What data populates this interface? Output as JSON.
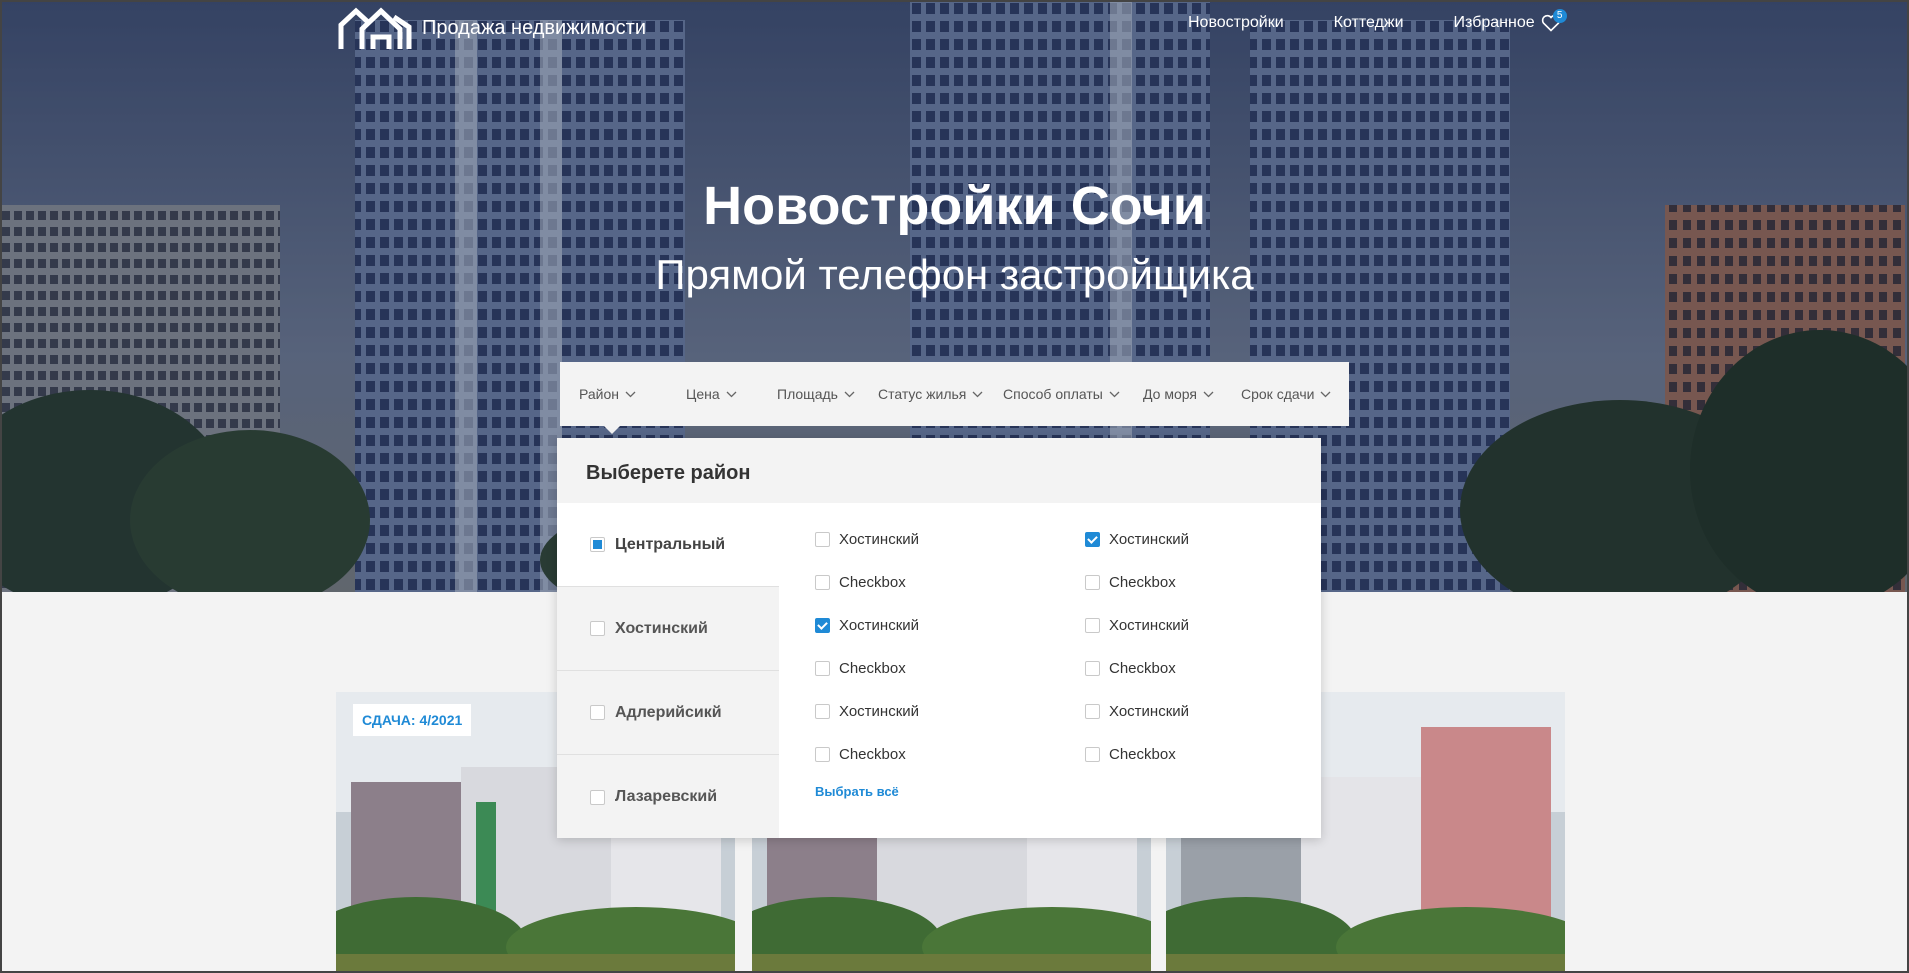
{
  "header": {
    "logo_text": "Продажа недвижимости",
    "nav": [
      "Новостройки",
      "Коттеджи",
      "Избранное"
    ],
    "favorites_count": "5"
  },
  "hero": {
    "title": "Новостройки Сочи",
    "subtitle": "Прямой телефон застройщика"
  },
  "filters": [
    "Район",
    "Цена",
    "Площадь",
    "Статус жилья",
    "Способ оплаты",
    "До моря",
    "Срок сдачи"
  ],
  "dropdown": {
    "title": "Выберете район",
    "districts": [
      {
        "label": "Центральный",
        "state": "partial"
      },
      {
        "label": "Хостинский",
        "state": "unchecked"
      },
      {
        "label": "Адлерийсикй",
        "state": "unchecked"
      },
      {
        "label": "Лазаревский",
        "state": "unchecked"
      }
    ],
    "options": [
      {
        "label": "Хостинский",
        "checked": false
      },
      {
        "label": "Хостинский",
        "checked": true
      },
      {
        "label": "Checkbox",
        "checked": false
      },
      {
        "label": "Checkbox",
        "checked": false
      },
      {
        "label": "Хостинский",
        "checked": true
      },
      {
        "label": "Хостинский",
        "checked": false
      },
      {
        "label": "Checkbox",
        "checked": false
      },
      {
        "label": "Checkbox",
        "checked": false
      },
      {
        "label": "Хостинский",
        "checked": false
      },
      {
        "label": "Хостинский",
        "checked": false
      },
      {
        "label": "Checkbox",
        "checked": false
      },
      {
        "label": "Checkbox",
        "checked": false
      }
    ],
    "select_all": "Выбрать всё"
  },
  "cards": [
    {
      "tag": "СДАЧА: 4/2021"
    }
  ],
  "colors": {
    "accent": "#1f8ad6",
    "panel_bg": "#f3f3f3",
    "page_bg": "#f3f3f3"
  }
}
